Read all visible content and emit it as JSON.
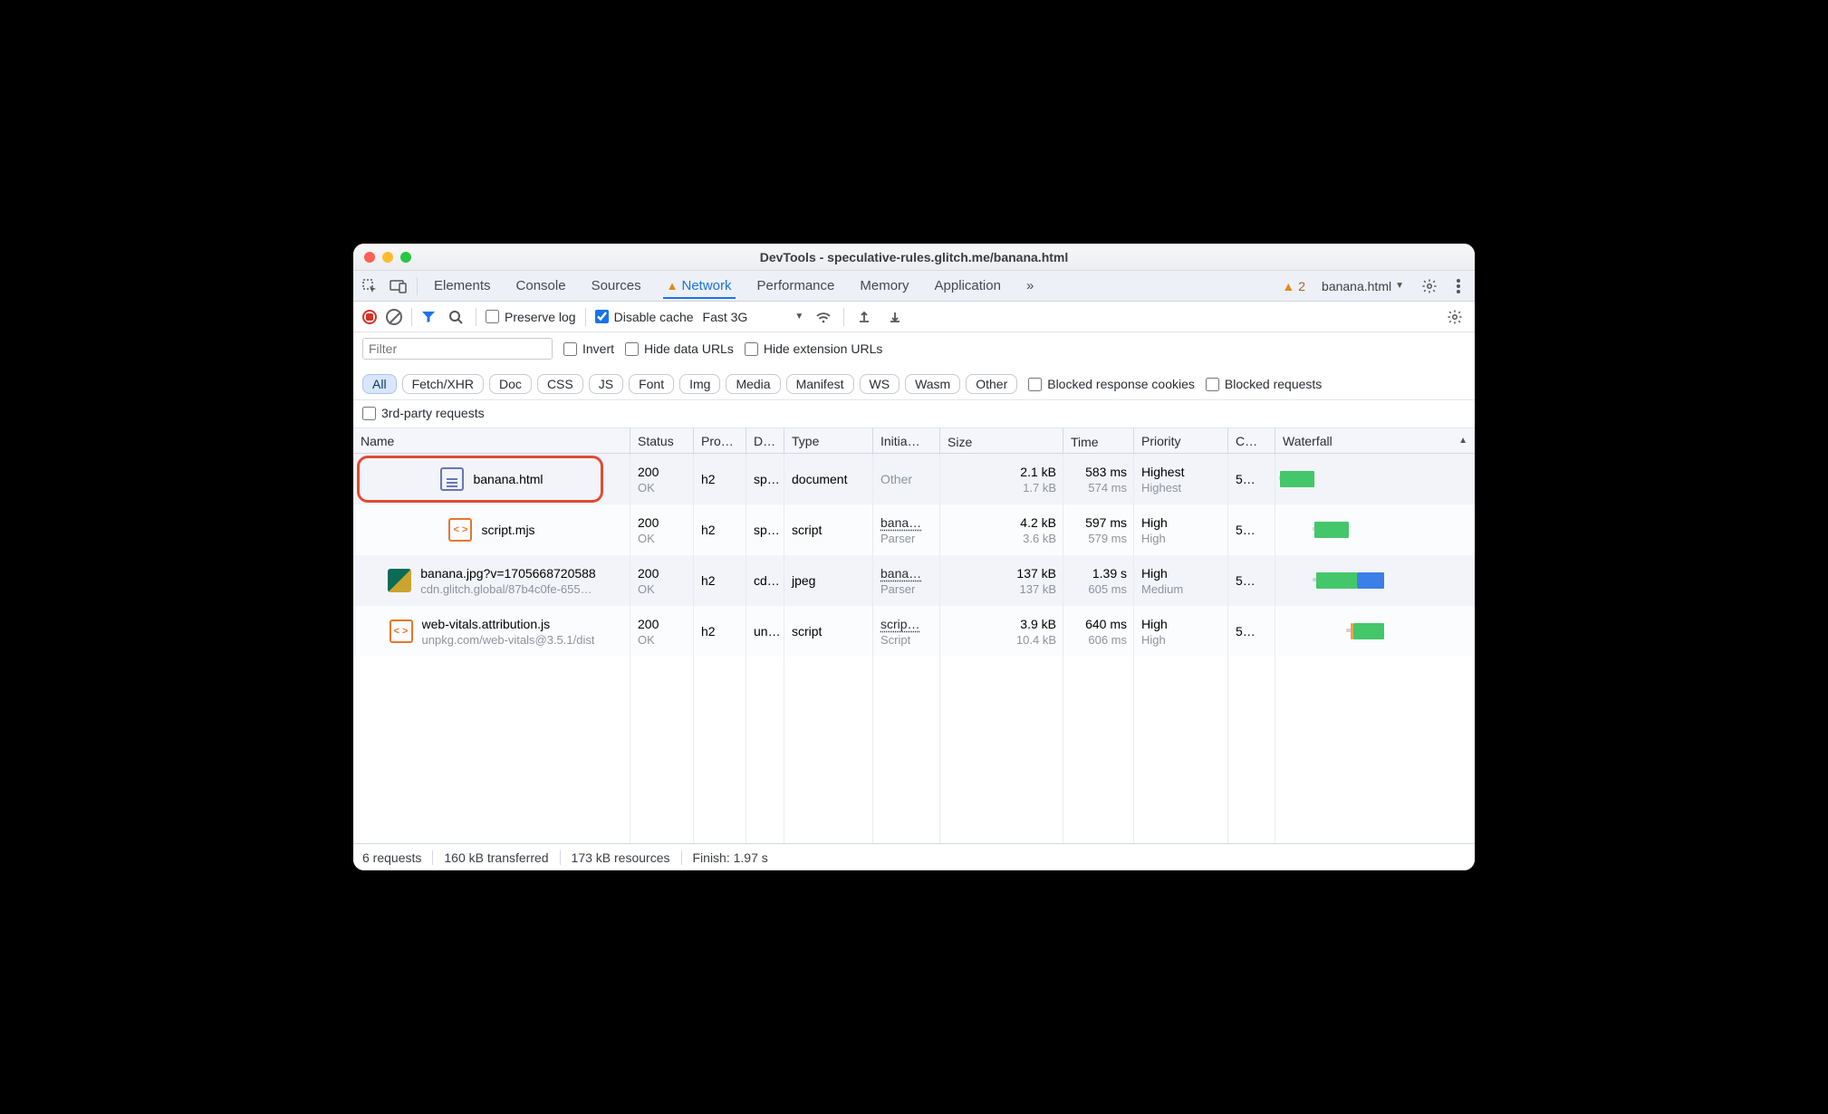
{
  "window": {
    "title": "DevTools - speculative-rules.glitch.me/banana.html"
  },
  "tabs": {
    "elements": "Elements",
    "console": "Console",
    "sources": "Sources",
    "network": "Network",
    "performance": "Performance",
    "memory": "Memory",
    "application": "Application"
  },
  "issues_count": "2",
  "target": "banana.html",
  "toolbar": {
    "preserve_log": "Preserve log",
    "disable_cache": "Disable cache",
    "throttle": "Fast 3G"
  },
  "filter": {
    "placeholder": "Filter",
    "invert": "Invert",
    "hide_data": "Hide data URLs",
    "hide_ext": "Hide extension URLs",
    "types": [
      "All",
      "Fetch/XHR",
      "Doc",
      "CSS",
      "JS",
      "Font",
      "Img",
      "Media",
      "Manifest",
      "WS",
      "Wasm",
      "Other"
    ],
    "blocked_cookies": "Blocked response cookies",
    "blocked_req": "Blocked requests",
    "third_party": "3rd-party requests"
  },
  "columns": {
    "name": "Name",
    "status": "Status",
    "protocol": "Pro…",
    "domain": "D…",
    "type": "Type",
    "initiator": "Initia…",
    "size": "Size",
    "time": "Time",
    "priority": "Priority",
    "connection": "C…",
    "waterfall": "Waterfall"
  },
  "rows": [
    {
      "name": "banana.html",
      "name_sub": "",
      "icon": "doc",
      "status": "200",
      "status_sub": "OK",
      "protocol": "h2",
      "domain": "sp…",
      "type": "document",
      "initiator": "Other",
      "initiator_sub": "",
      "initiator_link": false,
      "size": "2.1 kB",
      "size_sub": "1.7 kB",
      "time": "583 ms",
      "time_sub": "574 ms",
      "priority": "Highest",
      "priority_sub": "Highest",
      "conn": "5…",
      "wf": {
        "wait_l": 4,
        "wait_w": 2,
        "main_l": 5,
        "main_w": 38
      }
    },
    {
      "name": "script.mjs",
      "name_sub": "",
      "icon": "js",
      "status": "200",
      "status_sub": "OK",
      "protocol": "h2",
      "domain": "sp…",
      "type": "script",
      "initiator": "bana…",
      "initiator_sub": "Parser",
      "initiator_link": true,
      "size": "4.2 kB",
      "size_sub": "3.6 kB",
      "time": "597 ms",
      "time_sub": "579 ms",
      "priority": "High",
      "priority_sub": "High",
      "conn": "5…",
      "wf": {
        "wait_l": 41,
        "wait_w": 3,
        "main_l": 43,
        "main_w": 38
      }
    },
    {
      "name": "banana.jpg?v=1705668720588",
      "name_sub": "cdn.glitch.global/87b4c0fe-655…",
      "icon": "img",
      "status": "200",
      "status_sub": "OK",
      "protocol": "h2",
      "domain": "cd…",
      "type": "jpeg",
      "initiator": "bana…",
      "initiator_sub": "Parser",
      "initiator_link": true,
      "size": "137 kB",
      "size_sub": "137 kB",
      "time": "1.39 s",
      "time_sub": "605 ms",
      "priority": "High",
      "priority_sub": "Medium",
      "conn": "5…",
      "wf": {
        "wait_l": 41,
        "wait_w": 5,
        "main_l": 45,
        "main_w": 45,
        "blue_l": 90,
        "blue_w": 30
      }
    },
    {
      "name": "web-vitals.attribution.js",
      "name_sub": "unpkg.com/web-vitals@3.5.1/dist",
      "icon": "js",
      "status": "200",
      "status_sub": "OK",
      "protocol": "h2",
      "domain": "un…",
      "type": "script",
      "initiator": "scrip…",
      "initiator_sub": "Script",
      "initiator_link": true,
      "size": "3.9 kB",
      "size_sub": "10.4 kB",
      "time": "640 ms",
      "time_sub": "606 ms",
      "priority": "High",
      "priority_sub": "High",
      "conn": "5…",
      "wf": {
        "wait_l": 78,
        "wait_w": 6,
        "orange_l": 83,
        "orange_w": 3,
        "main_l": 86,
        "main_w": 34
      }
    }
  ],
  "footer": {
    "requests": "6 requests",
    "transferred": "160 kB transferred",
    "resources": "173 kB resources",
    "finish": "Finish: 1.97 s"
  }
}
